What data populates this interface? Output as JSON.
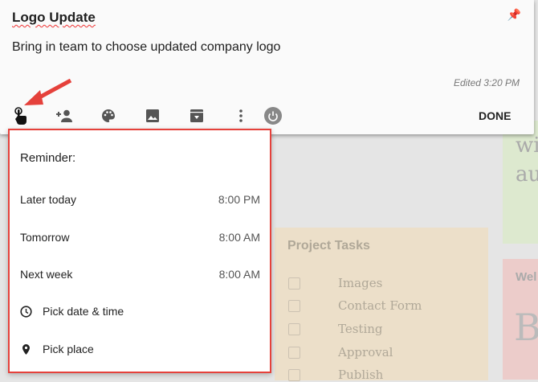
{
  "note": {
    "title": "Logo Update",
    "body": "Bring in team to choose updated company logo",
    "edited": "Edited 3:20 PM",
    "done": "DONE"
  },
  "toolbar": {
    "icons": [
      "remind-me-icon",
      "collaborator-icon",
      "palette-icon",
      "image-icon",
      "archive-icon",
      "more-icon",
      "power-icon"
    ]
  },
  "reminder": {
    "heading": "Reminder:",
    "options": [
      {
        "label": "Later today",
        "time": "8:00 PM"
      },
      {
        "label": "Tomorrow",
        "time": "8:00 AM"
      },
      {
        "label": "Next week",
        "time": "8:00 AM"
      }
    ],
    "pick_date": "Pick date & time",
    "pick_place": "Pick place"
  },
  "background": {
    "project_title": "Project Tasks",
    "tasks": [
      "Images",
      "Contact Form",
      "Testing",
      "Approval",
      "Publish"
    ],
    "green_text": [
      "wi",
      "au"
    ],
    "red_title": "Wel",
    "red_text": "B"
  },
  "colors": {
    "accent": "#e5413b"
  }
}
